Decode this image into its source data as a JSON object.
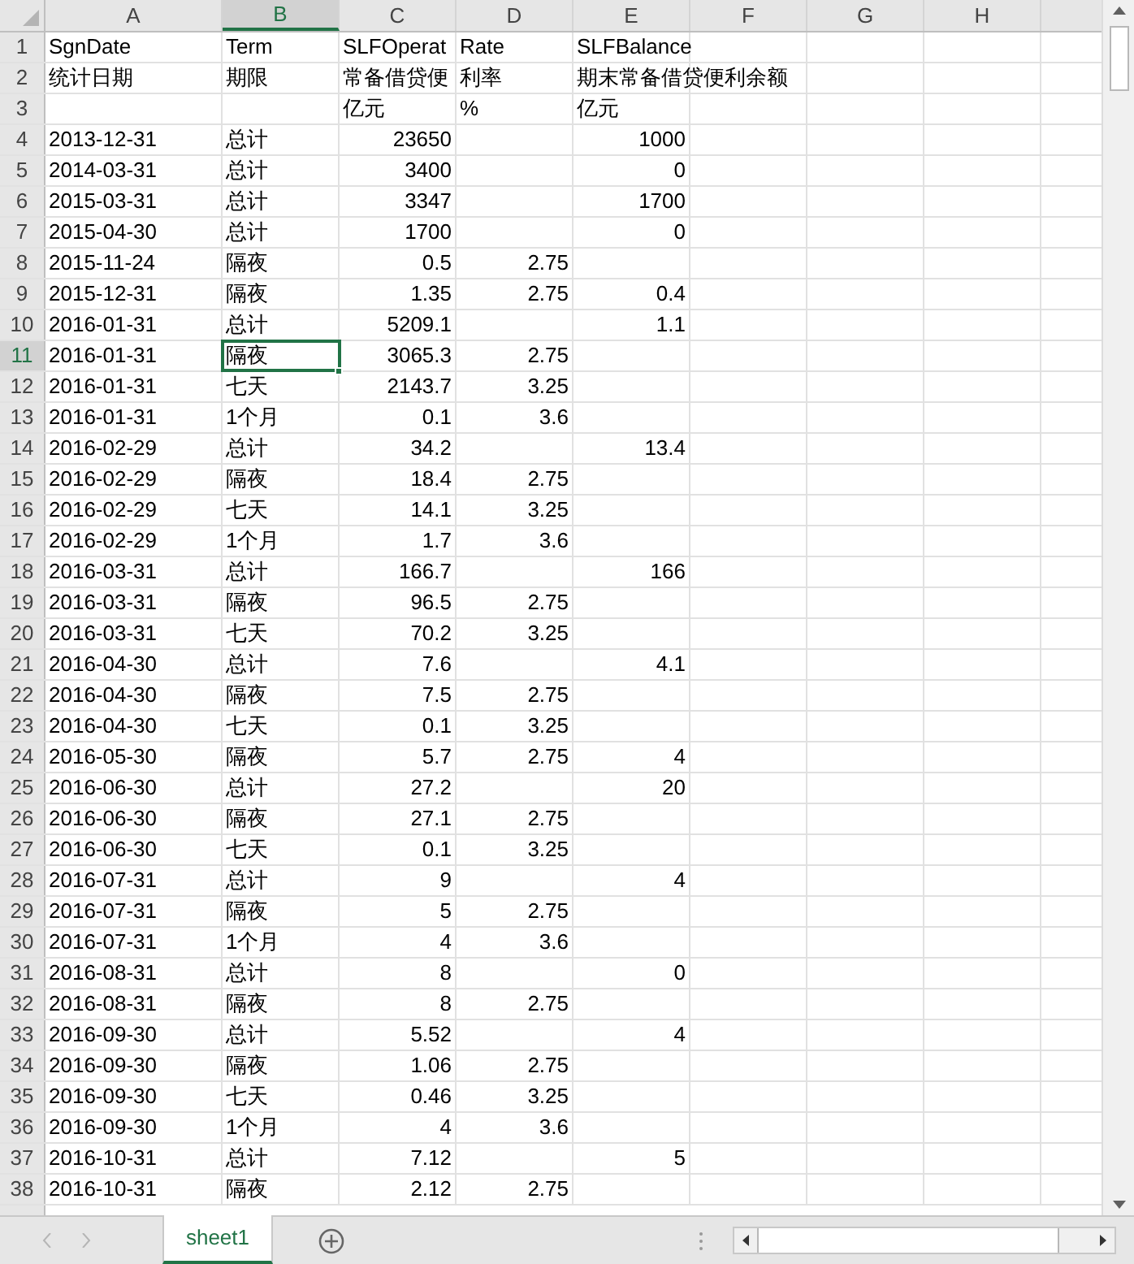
{
  "columns": [
    {
      "label": "A",
      "selected": false
    },
    {
      "label": "B",
      "selected": true
    },
    {
      "label": "C",
      "selected": false
    },
    {
      "label": "D",
      "selected": false
    },
    {
      "label": "E",
      "selected": false
    },
    {
      "label": "F",
      "selected": false
    },
    {
      "label": "G",
      "selected": false
    },
    {
      "label": "H",
      "selected": false
    }
  ],
  "rows": [
    {
      "number": "1",
      "selected": false,
      "cells": [
        "SgnDate",
        "Term",
        "SLFOperat",
        "Rate",
        "SLFBalance"
      ]
    },
    {
      "number": "2",
      "selected": false,
      "cells": [
        "统计日期",
        "期限",
        "常备借贷便",
        "利率",
        "期末常备借贷便利余额"
      ]
    },
    {
      "number": "3",
      "selected": false,
      "cells": [
        "",
        "",
        "亿元",
        "%",
        "亿元"
      ]
    },
    {
      "number": "4",
      "selected": false,
      "cells": [
        "2013-12-31",
        "总计",
        "23650",
        "",
        "1000"
      ]
    },
    {
      "number": "5",
      "selected": false,
      "cells": [
        "2014-03-31",
        "总计",
        "3400",
        "",
        "0"
      ]
    },
    {
      "number": "6",
      "selected": false,
      "cells": [
        "2015-03-31",
        "总计",
        "3347",
        "",
        "1700"
      ]
    },
    {
      "number": "7",
      "selected": false,
      "cells": [
        "2015-04-30",
        "总计",
        "1700",
        "",
        "0"
      ]
    },
    {
      "number": "8",
      "selected": false,
      "cells": [
        "2015-11-24",
        "隔夜",
        "0.5",
        "2.75",
        ""
      ]
    },
    {
      "number": "9",
      "selected": false,
      "cells": [
        "2015-12-31",
        "隔夜",
        "1.35",
        "2.75",
        "0.4"
      ]
    },
    {
      "number": "10",
      "selected": false,
      "cells": [
        "2016-01-31",
        "总计",
        "5209.1",
        "",
        "1.1"
      ]
    },
    {
      "number": "11",
      "selected": true,
      "cells": [
        "2016-01-31",
        "隔夜",
        "3065.3",
        "2.75",
        ""
      ]
    },
    {
      "number": "12",
      "selected": false,
      "cells": [
        "2016-01-31",
        "七天",
        "2143.7",
        "3.25",
        ""
      ]
    },
    {
      "number": "13",
      "selected": false,
      "cells": [
        "2016-01-31",
        "1个月",
        "0.1",
        "3.6",
        ""
      ]
    },
    {
      "number": "14",
      "selected": false,
      "cells": [
        "2016-02-29",
        "总计",
        "34.2",
        "",
        "13.4"
      ]
    },
    {
      "number": "15",
      "selected": false,
      "cells": [
        "2016-02-29",
        "隔夜",
        "18.4",
        "2.75",
        ""
      ]
    },
    {
      "number": "16",
      "selected": false,
      "cells": [
        "2016-02-29",
        "七天",
        "14.1",
        "3.25",
        ""
      ]
    },
    {
      "number": "17",
      "selected": false,
      "cells": [
        "2016-02-29",
        "1个月",
        "1.7",
        "3.6",
        ""
      ]
    },
    {
      "number": "18",
      "selected": false,
      "cells": [
        "2016-03-31",
        "总计",
        "166.7",
        "",
        "166"
      ]
    },
    {
      "number": "19",
      "selected": false,
      "cells": [
        "2016-03-31",
        "隔夜",
        "96.5",
        "2.75",
        ""
      ]
    },
    {
      "number": "20",
      "selected": false,
      "cells": [
        "2016-03-31",
        "七天",
        "70.2",
        "3.25",
        ""
      ]
    },
    {
      "number": "21",
      "selected": false,
      "cells": [
        "2016-04-30",
        "总计",
        "7.6",
        "",
        "4.1"
      ]
    },
    {
      "number": "22",
      "selected": false,
      "cells": [
        "2016-04-30",
        "隔夜",
        "7.5",
        "2.75",
        ""
      ]
    },
    {
      "number": "23",
      "selected": false,
      "cells": [
        "2016-04-30",
        "七天",
        "0.1",
        "3.25",
        ""
      ]
    },
    {
      "number": "24",
      "selected": false,
      "cells": [
        "2016-05-30",
        "隔夜",
        "5.7",
        "2.75",
        "4"
      ]
    },
    {
      "number": "25",
      "selected": false,
      "cells": [
        "2016-06-30",
        "总计",
        "27.2",
        "",
        "20"
      ]
    },
    {
      "number": "26",
      "selected": false,
      "cells": [
        "2016-06-30",
        "隔夜",
        "27.1",
        "2.75",
        ""
      ]
    },
    {
      "number": "27",
      "selected": false,
      "cells": [
        "2016-06-30",
        "七天",
        "0.1",
        "3.25",
        ""
      ]
    },
    {
      "number": "28",
      "selected": false,
      "cells": [
        "2016-07-31",
        "总计",
        "9",
        "",
        "4"
      ]
    },
    {
      "number": "29",
      "selected": false,
      "cells": [
        "2016-07-31",
        "隔夜",
        "5",
        "2.75",
        ""
      ]
    },
    {
      "number": "30",
      "selected": false,
      "cells": [
        "2016-07-31",
        "1个月",
        "4",
        "3.6",
        ""
      ]
    },
    {
      "number": "31",
      "selected": false,
      "cells": [
        "2016-08-31",
        "总计",
        "8",
        "",
        "0"
      ]
    },
    {
      "number": "32",
      "selected": false,
      "cells": [
        "2016-08-31",
        "隔夜",
        "8",
        "2.75",
        ""
      ]
    },
    {
      "number": "33",
      "selected": false,
      "cells": [
        "2016-09-30",
        "总计",
        "5.52",
        "",
        "4"
      ]
    },
    {
      "number": "34",
      "selected": false,
      "cells": [
        "2016-09-30",
        "隔夜",
        "1.06",
        "2.75",
        ""
      ]
    },
    {
      "number": "35",
      "selected": false,
      "cells": [
        "2016-09-30",
        "七天",
        "0.46",
        "3.25",
        ""
      ]
    },
    {
      "number": "36",
      "selected": false,
      "cells": [
        "2016-09-30",
        "1个月",
        "4",
        "3.6",
        ""
      ]
    },
    {
      "number": "37",
      "selected": false,
      "cells": [
        "2016-10-31",
        "总计",
        "7.12",
        "",
        "5"
      ]
    },
    {
      "number": "38",
      "selected": false,
      "cells": [
        "2016-10-31",
        "隔夜",
        "2.12",
        "2.75",
        ""
      ]
    }
  ],
  "sheet_tabs": [
    {
      "label": "sheet1",
      "selected": true
    }
  ]
}
